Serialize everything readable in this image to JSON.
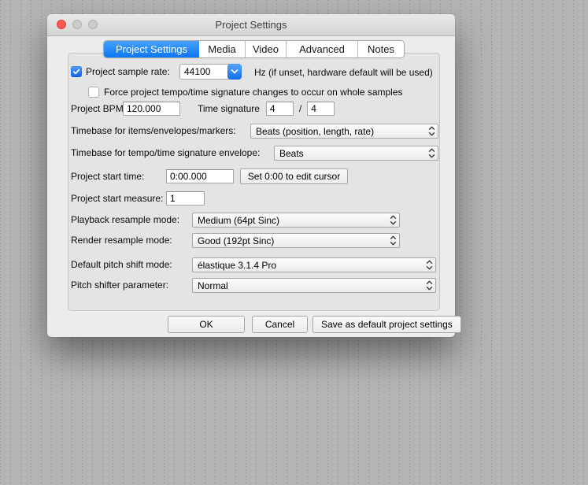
{
  "window": {
    "title": "Project Settings"
  },
  "tabs": [
    {
      "label": "Project Settings",
      "selected": true
    },
    {
      "label": "Media",
      "selected": false
    },
    {
      "label": "Video",
      "selected": false
    },
    {
      "label": "Advanced",
      "selected": false
    },
    {
      "label": "Notes",
      "selected": false
    }
  ],
  "rows": {
    "sample_rate": {
      "checked": true,
      "label": "Project sample rate:",
      "value": "44100",
      "suffix": "Hz (if unset, hardware default will be used)"
    },
    "force_whole_samples": {
      "checked": false,
      "label": "Force project tempo/time signature changes to occur on whole samples"
    },
    "bpm": {
      "label": "Project BPM:",
      "value": "120.000"
    },
    "time_signature": {
      "label": "Time signature",
      "numerator": "4",
      "separator": "/",
      "denominator": "4"
    },
    "timebase_items": {
      "label": "Timebase for items/envelopes/markers:",
      "value": "Beats (position, length, rate)"
    },
    "timebase_tempo": {
      "label": "Timebase for tempo/time signature envelope:",
      "value": "Beats"
    },
    "start_time": {
      "label": "Project start time:",
      "value": "0:00.000",
      "button": "Set 0:00 to edit cursor"
    },
    "start_measure": {
      "label": "Project start measure:",
      "value": "1"
    },
    "playback_resample": {
      "label": "Playback resample mode:",
      "value": "Medium (64pt Sinc)"
    },
    "render_resample": {
      "label": "Render resample mode:",
      "value": "Good (192pt Sinc)"
    },
    "pitch_shift": {
      "label": "Default pitch shift mode:",
      "value": "élastique 3.1.4 Pro"
    },
    "pitch_param": {
      "label": "Pitch shifter parameter:",
      "value": "Normal"
    }
  },
  "buttons": {
    "ok": "OK",
    "cancel": "Cancel",
    "save_default": "Save as default project settings"
  },
  "colors": {
    "accent_blue": "#0d76f1",
    "checkbox_blue": "#1464e8",
    "traffic_red": "#fd5950",
    "window_bg": "#ececec",
    "panel_bg": "#e4e4e4",
    "desktop_bg": "#b5b5b3"
  }
}
